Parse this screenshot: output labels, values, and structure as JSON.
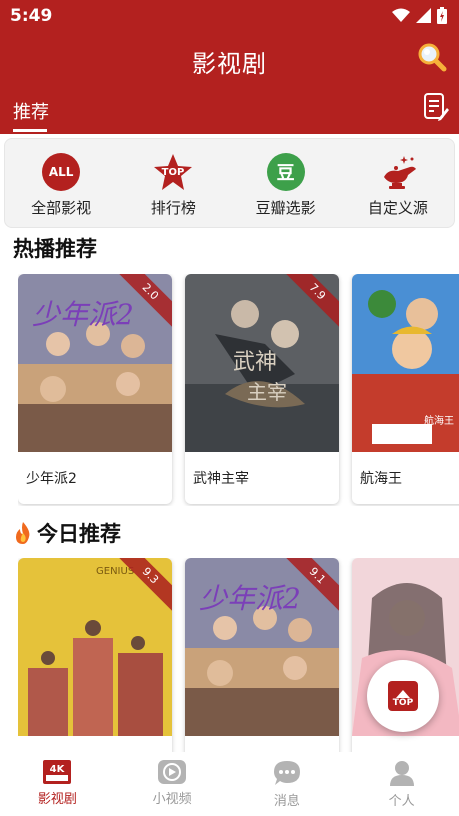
{
  "status_bar": {
    "time": "5:49"
  },
  "header": {
    "title": "影视剧",
    "tab_label": "推荐"
  },
  "quick_links": [
    {
      "label": "全部影视",
      "icon": "all-icon",
      "badge": "ALL"
    },
    {
      "label": "排行榜",
      "icon": "top-star-icon",
      "badge": "TOP"
    },
    {
      "label": "豆瓣选影",
      "icon": "douban-icon",
      "badge": "豆"
    },
    {
      "label": "自定义源",
      "icon": "magic-lamp-icon"
    }
  ],
  "hot_section": {
    "title": "热播推荐",
    "items": [
      {
        "name": "少年派2",
        "rating": "2.0"
      },
      {
        "name": "武神主宰",
        "rating": "7.9"
      },
      {
        "name": "航海王",
        "rating": ""
      }
    ]
  },
  "today_section": {
    "title": "今日推荐",
    "items": [
      {
        "name": "",
        "rating": "9.3"
      },
      {
        "name": "",
        "rating": "9.1"
      },
      {
        "name": "",
        "rating": ""
      }
    ]
  },
  "fab": {
    "label": "TOP"
  },
  "bottom_nav": [
    {
      "label": "影视剧",
      "icon": "4k-film-icon",
      "active": true
    },
    {
      "label": "小视频",
      "icon": "play-icon",
      "active": false
    },
    {
      "label": "消息",
      "icon": "chat-icon",
      "active": false
    },
    {
      "label": "个人",
      "icon": "person-icon",
      "active": false
    }
  ],
  "colors": {
    "brand_red": "#b3211f",
    "douban_green": "#3da04a",
    "nav_inactive": "#999999"
  }
}
